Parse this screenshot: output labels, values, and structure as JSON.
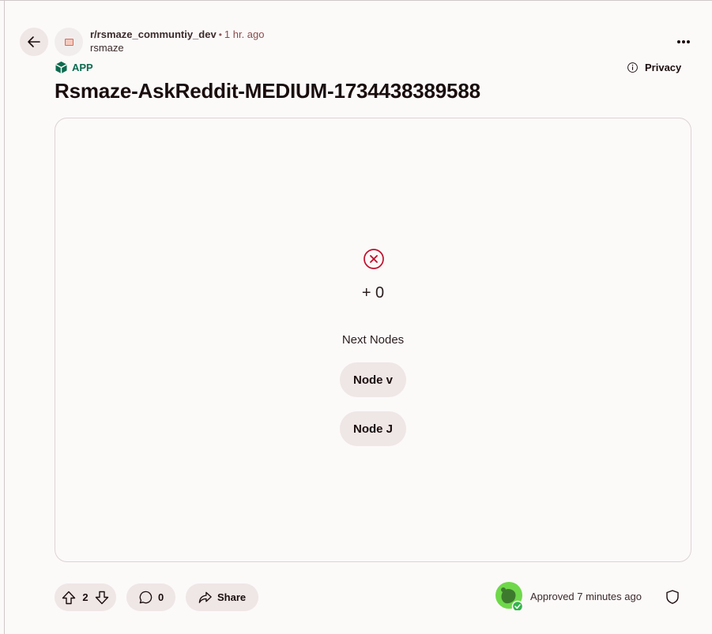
{
  "post": {
    "subreddit": "r/rsmaze_communtiy_dev",
    "separator": "•",
    "time_ago": "1 hr. ago",
    "author": "rsmaze",
    "app_badge": "APP",
    "privacy_label": "Privacy",
    "title": "Rsmaze-AskReddit-MEDIUM-1734438389588"
  },
  "game": {
    "status_icon": "x-circle-icon",
    "score": "+ 0",
    "next_label": "Next Nodes",
    "nodes": [
      "Node v",
      "Node J"
    ]
  },
  "actions": {
    "upvotes": "2",
    "comments": "0",
    "share_label": "Share",
    "approved_text": "Approved 7 minutes ago"
  },
  "colors": {
    "accent_green": "#0c6b4f",
    "error_red": "#c0102c",
    "pill_bg": "#efe6e6",
    "page_bg": "#fcf9f9"
  }
}
